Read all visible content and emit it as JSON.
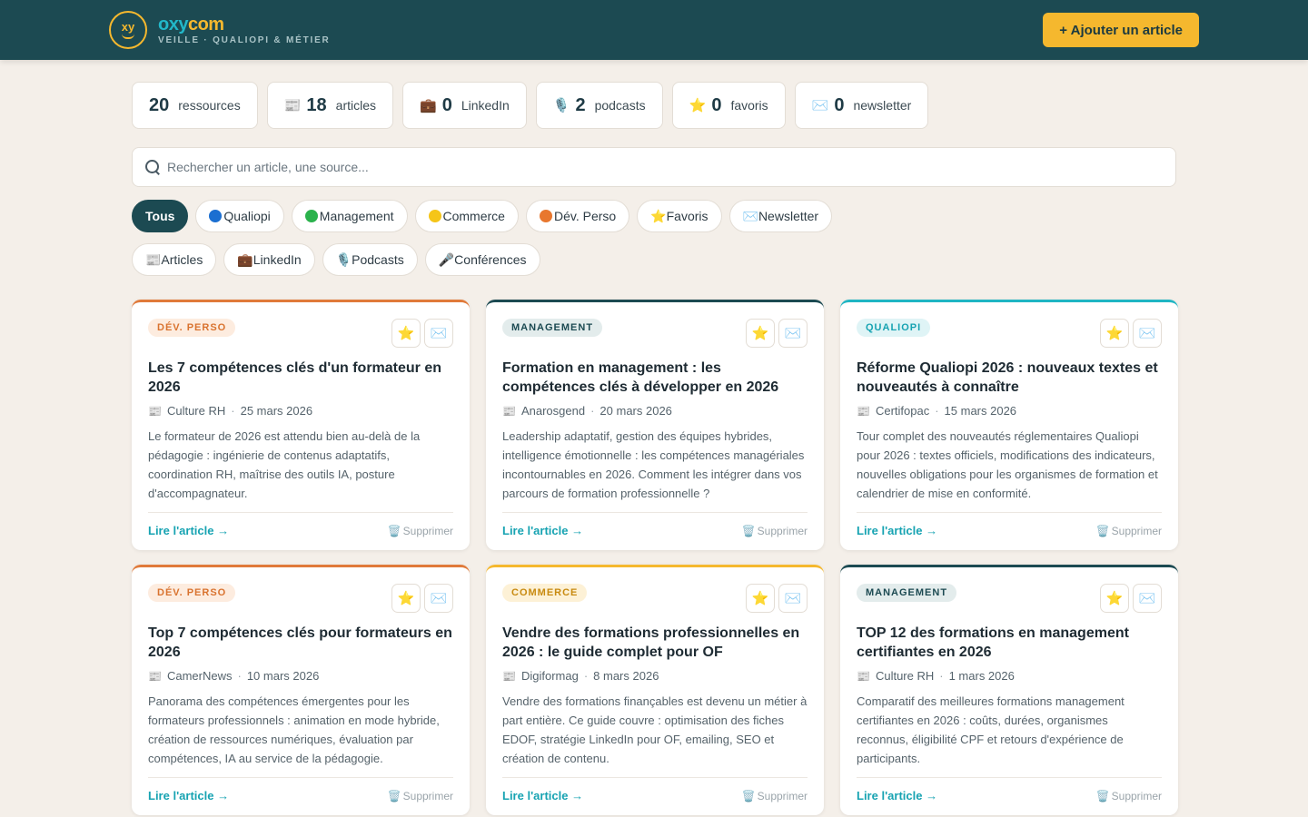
{
  "header": {
    "brand_name_a": "oxy",
    "brand_name_b": "com",
    "brand_sub": "VEILLE · QUALIOPI & MÉTIER",
    "logo_text": "xy",
    "add_label": "+ Ajouter un article"
  },
  "stats": [
    {
      "icon": "",
      "num": "20",
      "label": "ressources"
    },
    {
      "icon": "📰",
      "num": "18",
      "label": "articles"
    },
    {
      "icon": "💼",
      "num": "0",
      "label": "LinkedIn"
    },
    {
      "icon": "🎙️",
      "num": "2",
      "label": "podcasts"
    },
    {
      "icon": "⭐",
      "num": "0",
      "label": "favoris"
    },
    {
      "icon": "✉️",
      "num": "0",
      "label": "newsletter"
    }
  ],
  "search": {
    "placeholder": "Rechercher un article, une source..."
  },
  "filters_row1": [
    {
      "label": "Tous"
    },
    {
      "label": "Qualiopi",
      "dot": "#1b6fd1"
    },
    {
      "label": "Management",
      "dot": "#2bb24c"
    },
    {
      "label": "Commerce",
      "dot": "#f5c518"
    },
    {
      "label": "Dév. Perso",
      "dot": "#e8772e"
    },
    {
      "label": "⭐Favoris"
    },
    {
      "label": "✉️Newsletter"
    }
  ],
  "filters_row2": [
    {
      "label": "📰Articles"
    },
    {
      "label": "💼LinkedIn"
    },
    {
      "label": "🎙️Podcasts"
    },
    {
      "label": "🎤Conférences"
    }
  ],
  "cards": [
    {
      "tag": "DÉV. PERSO",
      "title": "Les 7 compétences clés d'un formateur en 2026",
      "source": "Culture RH",
      "date": "25 mars 2026",
      "desc": "Le formateur de 2026 est attendu bien au-delà de la pédagogie : ingénierie de contenus adaptatifs, coordination RH, maîtrise des outils IA, posture d'accompagnateur.",
      "read": "Lire l'article →",
      "delete": "Supprimer"
    },
    {
      "tag": "MANAGEMENT",
      "title": "Formation en management : les compétences clés à développer en 2026",
      "source": "Anarosgend",
      "date": "20 mars 2026",
      "desc": "Leadership adaptatif, gestion des équipes hybrides, intelligence émotionnelle : les compétences managériales incontournables en 2026. Comment les intégrer dans vos parcours de formation professionnelle ?",
      "read": "Lire l'article →",
      "delete": "Supprimer"
    },
    {
      "tag": "QUALIOPI",
      "title": "Réforme Qualiopi 2026 : nouveaux textes et nouveautés à connaître",
      "source": "Certifopac",
      "date": "15 mars 2026",
      "desc": "Tour complet des nouveautés réglementaires Qualiopi pour 2026 : textes officiels, modifications des indicateurs, nouvelles obligations pour les organismes de formation et calendrier de mise en conformité.",
      "read": "Lire l'article →",
      "delete": "Supprimer"
    },
    {
      "tag": "DÉV. PERSO",
      "title": "Top 7 compétences clés pour formateurs en 2026",
      "source": "CamerNews",
      "date": "10 mars 2026",
      "desc": "Panorama des compétences émergentes pour les formateurs professionnels : animation en mode hybride, création de ressources numériques, évaluation par compétences, IA au service de la pédagogie.",
      "read": "Lire l'article →",
      "delete": "Supprimer"
    },
    {
      "tag": "COMMERCE",
      "title": "Vendre des formations professionnelles en 2026 : le guide complet pour OF",
      "source": "Digiformag",
      "date": "8 mars 2026",
      "desc": "Vendre des formations finançables est devenu un métier à part entière. Ce guide couvre : optimisation des fiches EDOF, stratégie LinkedIn pour OF, emailing, SEO et création de contenu.",
      "read": "Lire l'article →",
      "delete": "Supprimer"
    },
    {
      "tag": "MANAGEMENT",
      "title": "TOP 12 des formations en management certifiantes en 2026",
      "source": "Culture RH",
      "date": "1 mars 2026",
      "desc": "Comparatif des meilleures formations management certifiantes en 2026 : coûts, durées, organismes reconnus, éligibilité CPF et retours d'expérience de participants.",
      "read": "Lire l'article →",
      "delete": "Supprimer"
    }
  ],
  "colors": {
    "header_bg": "#1c4a52",
    "accent_yellow": "#f5b82e",
    "link_cyan": "#17a3b2"
  }
}
